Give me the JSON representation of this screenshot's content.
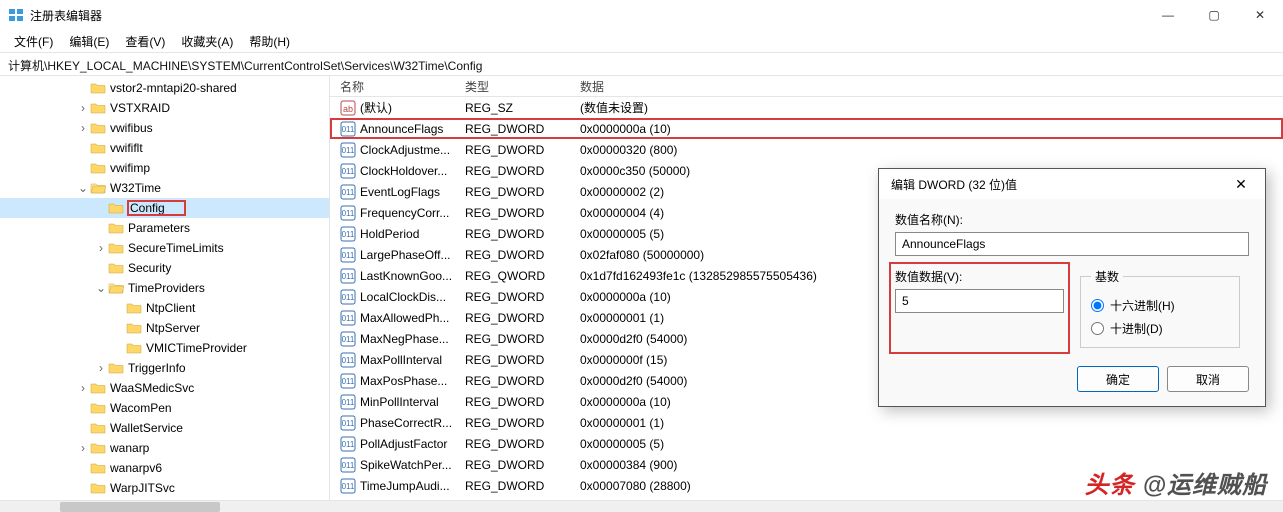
{
  "window": {
    "title": "注册表编辑器"
  },
  "menu": {
    "file": "文件(F)",
    "edit": "编辑(E)",
    "view": "查看(V)",
    "fav": "收藏夹(A)",
    "help": "帮助(H)"
  },
  "path": "计算机\\HKEY_LOCAL_MACHINE\\SYSTEM\\CurrentControlSet\\Services\\W32Time\\Config",
  "tree": [
    {
      "label": "vstor2-mntapi20-shared",
      "depth": 4,
      "twist": ""
    },
    {
      "label": "VSTXRAID",
      "depth": 4,
      "twist": "›"
    },
    {
      "label": "vwifibus",
      "depth": 4,
      "twist": "›"
    },
    {
      "label": "vwififlt",
      "depth": 4,
      "twist": ""
    },
    {
      "label": "vwifimp",
      "depth": 4,
      "twist": ""
    },
    {
      "label": "W32Time",
      "depth": 4,
      "twist": "⌄",
      "sel": false
    },
    {
      "label": "Config",
      "depth": 5,
      "twist": "",
      "sel": true,
      "hl": true
    },
    {
      "label": "Parameters",
      "depth": 5,
      "twist": ""
    },
    {
      "label": "SecureTimeLimits",
      "depth": 5,
      "twist": "›"
    },
    {
      "label": "Security",
      "depth": 5,
      "twist": ""
    },
    {
      "label": "TimeProviders",
      "depth": 5,
      "twist": "⌄"
    },
    {
      "label": "NtpClient",
      "depth": 6,
      "twist": ""
    },
    {
      "label": "NtpServer",
      "depth": 6,
      "twist": ""
    },
    {
      "label": "VMICTimeProvider",
      "depth": 6,
      "twist": ""
    },
    {
      "label": "TriggerInfo",
      "depth": 5,
      "twist": "›"
    },
    {
      "label": "WaaSMedicSvc",
      "depth": 4,
      "twist": "›"
    },
    {
      "label": "WacomPen",
      "depth": 4,
      "twist": ""
    },
    {
      "label": "WalletService",
      "depth": 4,
      "twist": ""
    },
    {
      "label": "wanarp",
      "depth": 4,
      "twist": "›"
    },
    {
      "label": "wanarpv6",
      "depth": 4,
      "twist": ""
    },
    {
      "label": "WarpJITSvc",
      "depth": 4,
      "twist": ""
    }
  ],
  "list": {
    "cols": {
      "name": "名称",
      "type": "类型",
      "data": "数据"
    },
    "rows": [
      {
        "icon": "sz",
        "name": "(默认)",
        "type": "REG_SZ",
        "data": "(数值未设置)"
      },
      {
        "icon": "dw",
        "name": "AnnounceFlags",
        "type": "REG_DWORD",
        "data": "0x0000000a (10)",
        "hl": true
      },
      {
        "icon": "dw",
        "name": "ClockAdjustme...",
        "type": "REG_DWORD",
        "data": "0x00000320 (800)"
      },
      {
        "icon": "dw",
        "name": "ClockHoldover...",
        "type": "REG_DWORD",
        "data": "0x0000c350 (50000)"
      },
      {
        "icon": "dw",
        "name": "EventLogFlags",
        "type": "REG_DWORD",
        "data": "0x00000002 (2)"
      },
      {
        "icon": "dw",
        "name": "FrequencyCorr...",
        "type": "REG_DWORD",
        "data": "0x00000004 (4)"
      },
      {
        "icon": "dw",
        "name": "HoldPeriod",
        "type": "REG_DWORD",
        "data": "0x00000005 (5)"
      },
      {
        "icon": "dw",
        "name": "LargePhaseOff...",
        "type": "REG_DWORD",
        "data": "0x02faf080 (50000000)"
      },
      {
        "icon": "dw",
        "name": "LastKnownGoo...",
        "type": "REG_QWORD",
        "data": "0x1d7fd162493fe1c (132852985575505436)"
      },
      {
        "icon": "dw",
        "name": "LocalClockDis...",
        "type": "REG_DWORD",
        "data": "0x0000000a (10)"
      },
      {
        "icon": "dw",
        "name": "MaxAllowedPh...",
        "type": "REG_DWORD",
        "data": "0x00000001 (1)"
      },
      {
        "icon": "dw",
        "name": "MaxNegPhase...",
        "type": "REG_DWORD",
        "data": "0x0000d2f0 (54000)"
      },
      {
        "icon": "dw",
        "name": "MaxPollInterval",
        "type": "REG_DWORD",
        "data": "0x0000000f (15)"
      },
      {
        "icon": "dw",
        "name": "MaxPosPhase...",
        "type": "REG_DWORD",
        "data": "0x0000d2f0 (54000)"
      },
      {
        "icon": "dw",
        "name": "MinPollInterval",
        "type": "REG_DWORD",
        "data": "0x0000000a (10)"
      },
      {
        "icon": "dw",
        "name": "PhaseCorrectR...",
        "type": "REG_DWORD",
        "data": "0x00000001 (1)"
      },
      {
        "icon": "dw",
        "name": "PollAdjustFactor",
        "type": "REG_DWORD",
        "data": "0x00000005 (5)"
      },
      {
        "icon": "dw",
        "name": "SpikeWatchPer...",
        "type": "REG_DWORD",
        "data": "0x00000384 (900)"
      },
      {
        "icon": "dw",
        "name": "TimeJumpAudi...",
        "type": "REG_DWORD",
        "data": "0x00007080 (28800)"
      }
    ]
  },
  "dialog": {
    "title": "编辑 DWORD (32 位)值",
    "name_label": "数值名称(N):",
    "name_value": "AnnounceFlags",
    "data_label": "数值数据(V):",
    "data_value": "5",
    "base_label": "基数",
    "hex": "十六进制(H)",
    "dec": "十进制(D)",
    "ok": "确定",
    "cancel": "取消"
  },
  "watermark": {
    "a": "头条",
    "b": "@运维贼船"
  }
}
